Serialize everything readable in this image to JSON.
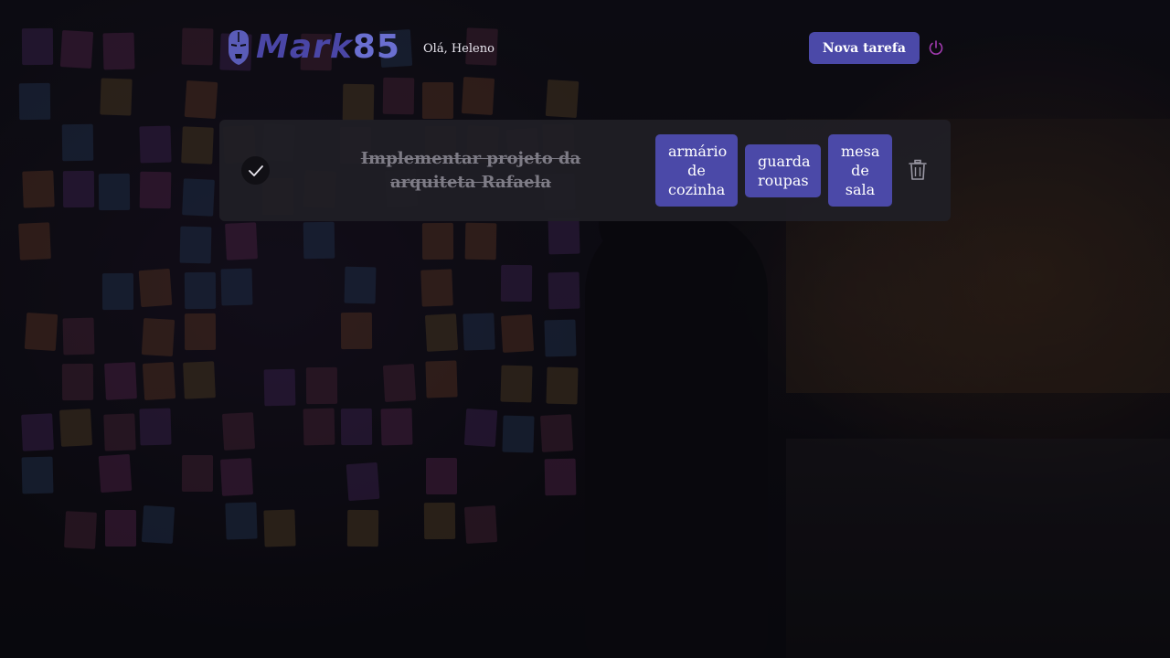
{
  "header": {
    "logo_text_part1": "Mark",
    "logo_text_part2": "85",
    "greeting": "Olá, Heleno",
    "new_task_label": "Nova tarefa"
  },
  "task": {
    "title": "Implementar projeto da arquiteta Rafaela",
    "completed": true,
    "tags": [
      "armário de cozinha",
      "guarda roupas",
      "mesa de sala"
    ]
  },
  "icons": {
    "logo": "iron-mask-icon",
    "logout": "power-icon",
    "check": "checkmark-icon",
    "delete": "trash-icon"
  },
  "colors": {
    "accent": "#4b49a8",
    "logout": "#a23bb0",
    "card_bg": "#201f25",
    "muted_text": "#7e7c86"
  }
}
